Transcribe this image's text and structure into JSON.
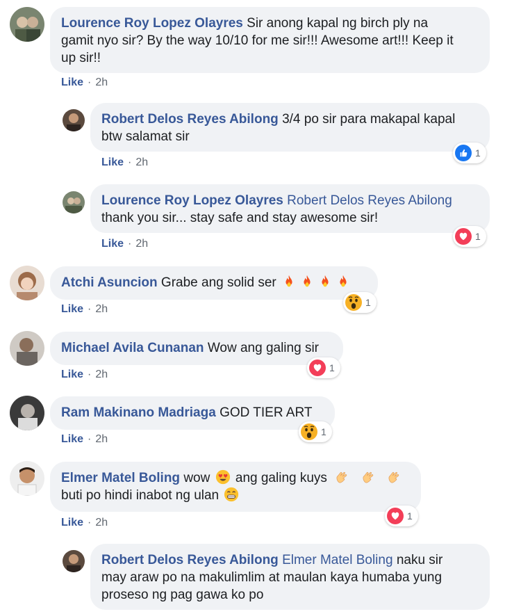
{
  "comments": [
    {
      "author": "Lourence Roy Lopez Olayres",
      "text_lines": [
        "Sir anong kapal ng birch ply na",
        "gamit nyo sir? By the way 10/10 for me sir!!! Awesome art!!! Keep it",
        "up sir!!"
      ],
      "like_label": "Like",
      "time": "2h"
    },
    {
      "author": "Robert Delos Reyes Abilong",
      "text_lines": [
        "3/4 po sir para makapal kapal",
        "btw salamat sir"
      ],
      "like_label": "Like",
      "time": "2h",
      "reaction": {
        "type": "like",
        "count": "1"
      }
    },
    {
      "author": "Lourence Roy Lopez Olayres",
      "mention": "Robert Delos Reyes Abilong",
      "text_lines": [
        "thank you sir... stay safe and stay awesome sir!"
      ],
      "like_label": "Like",
      "time": "2h",
      "reaction": {
        "type": "love",
        "count": "1"
      }
    },
    {
      "author": "Atchi Asuncion",
      "text": "Grabe ang solid ser",
      "like_label": "Like",
      "time": "2h",
      "reaction": {
        "type": "wow",
        "count": "1"
      }
    },
    {
      "author": "Michael Avila Cunanan",
      "text": "Wow ang galing sir",
      "like_label": "Like",
      "time": "2h",
      "reaction": {
        "type": "love",
        "count": "1"
      }
    },
    {
      "author": "Ram Makinano Madriaga",
      "text": "GOD TIER ART",
      "like_label": "Like",
      "time": "2h",
      "reaction": {
        "type": "wow",
        "count": "1"
      }
    },
    {
      "author": "Elmer Matel Boling",
      "text_a": "wow",
      "text_b": "ang galing kuys",
      "text_c": "buti po hindi inabot ng ulan",
      "like_label": "Like",
      "time": "2h",
      "reaction": {
        "type": "love",
        "count": "1"
      }
    },
    {
      "author": "Robert Delos Reyes Abilong",
      "mention": "Elmer Matel Boling",
      "text_lines": [
        "naku sir",
        "may araw po na makulimlim at maulan kaya humaba yung",
        "proseso ng pag gawa ko po"
      ]
    }
  ],
  "separator": "·",
  "colors": {
    "author": "#385898",
    "bubble": "#f0f2f5",
    "like": "#1877f2",
    "love": "#f33e58",
    "wow": "#f7b125"
  }
}
